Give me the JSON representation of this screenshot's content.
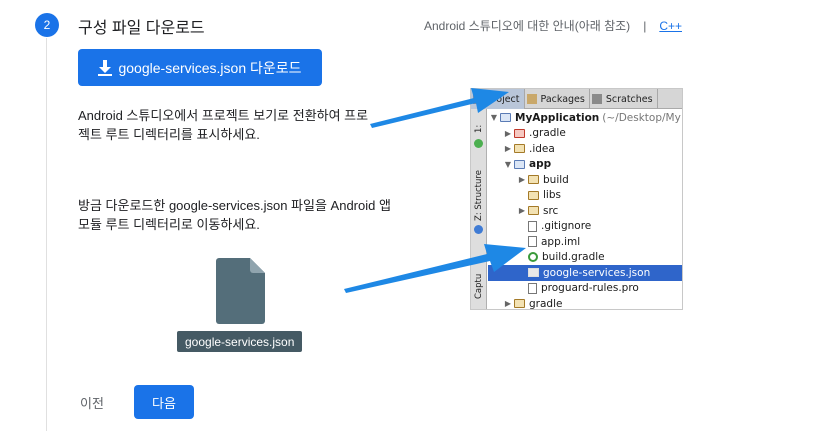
{
  "step": {
    "number": "2",
    "title": "구성 파일 다운로드"
  },
  "header_links": {
    "android_guide": "Android 스튜디오에 대한 안내(아래 참조)",
    "separator": "|",
    "cpp": "C++"
  },
  "download_button": {
    "label": "google-services.json 다운로드"
  },
  "instructions": {
    "switch_view": "Android 스튜디오에서 프로젝트 보기로 전환하여 프로젝트 루트 디렉터리를 표시하세요.",
    "move_file": "방금 다운로드한 google-services.json 파일을 Android 앱 모듈 루트 디렉터리로 이동하세요."
  },
  "file_card": {
    "filename": "google-services.json"
  },
  "ide": {
    "tabs": [
      "Project",
      "Packages",
      "Scratches"
    ],
    "side_labels": [
      "1:",
      "Z: Structure",
      "Captu"
    ],
    "tree": {
      "root_name": "MyApplication",
      "root_path": "(~/Desktop/My",
      "items": [
        ".gradle",
        ".idea",
        "app",
        "build",
        "libs",
        "src",
        ".gitignore",
        "app.iml",
        "build.gradle",
        "google-services.json",
        "proguard-rules.pro",
        "gradle"
      ]
    }
  },
  "footer": {
    "prev_label": "이전",
    "next_label": "다음"
  },
  "colors": {
    "primary": "#1a73e8",
    "file_card": "#455a64",
    "arrow": "#1e88e5",
    "selection": "#2f65ca"
  }
}
